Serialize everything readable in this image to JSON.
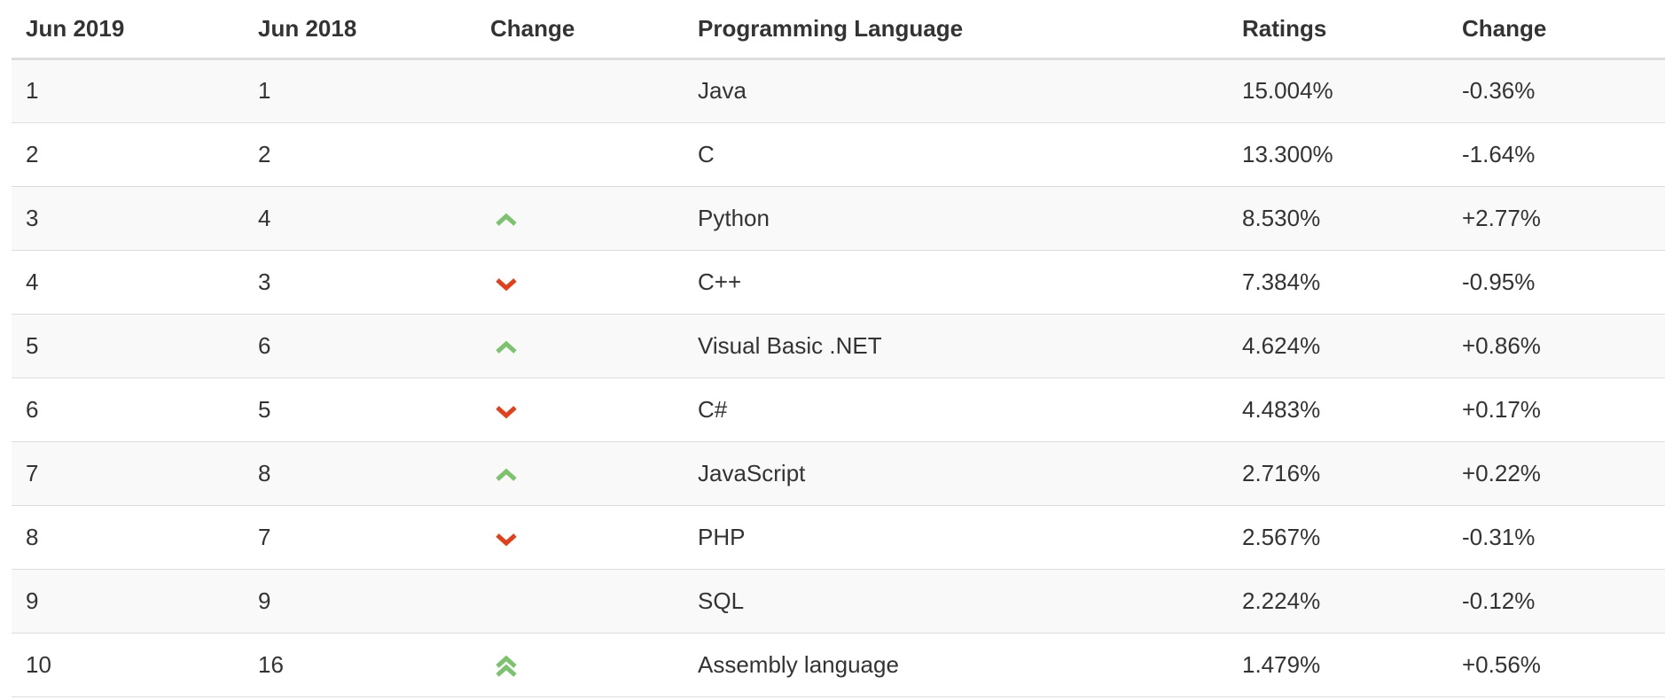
{
  "table": {
    "headers": [
      "Jun 2019",
      "Jun 2018",
      "Change",
      "Programming Language",
      "Ratings",
      "Change"
    ],
    "rows": [
      {
        "rank_2019": "1",
        "rank_2018": "1",
        "trend": "none",
        "language": "Java",
        "rating": "15.004%",
        "change": "-0.36%"
      },
      {
        "rank_2019": "2",
        "rank_2018": "2",
        "trend": "none",
        "language": "C",
        "rating": "13.300%",
        "change": "-1.64%"
      },
      {
        "rank_2019": "3",
        "rank_2018": "4",
        "trend": "up",
        "language": "Python",
        "rating": "8.530%",
        "change": "+2.77%"
      },
      {
        "rank_2019": "4",
        "rank_2018": "3",
        "trend": "down",
        "language": "C++",
        "rating": "7.384%",
        "change": "-0.95%"
      },
      {
        "rank_2019": "5",
        "rank_2018": "6",
        "trend": "up",
        "language": "Visual Basic .NET",
        "rating": "4.624%",
        "change": "+0.86%"
      },
      {
        "rank_2019": "6",
        "rank_2018": "5",
        "trend": "down",
        "language": "C#",
        "rating": "4.483%",
        "change": "+0.17%"
      },
      {
        "rank_2019": "7",
        "rank_2018": "8",
        "trend": "up",
        "language": "JavaScript",
        "rating": "2.716%",
        "change": "+0.22%"
      },
      {
        "rank_2019": "8",
        "rank_2018": "7",
        "trend": "down",
        "language": "PHP",
        "rating": "2.567%",
        "change": "-0.31%"
      },
      {
        "rank_2019": "9",
        "rank_2018": "9",
        "trend": "none",
        "language": "SQL",
        "rating": "2.224%",
        "change": "-0.12%"
      },
      {
        "rank_2019": "10",
        "rank_2018": "16",
        "trend": "double-up",
        "language": "Assembly language",
        "rating": "1.479%",
        "change": "+0.56%"
      }
    ]
  },
  "icons": {
    "up": "chevron-up-icon",
    "down": "chevron-down-icon",
    "double-up": "double-chevron-up-icon"
  },
  "colors": {
    "up": "#7dc36f",
    "down": "#e0401c"
  }
}
